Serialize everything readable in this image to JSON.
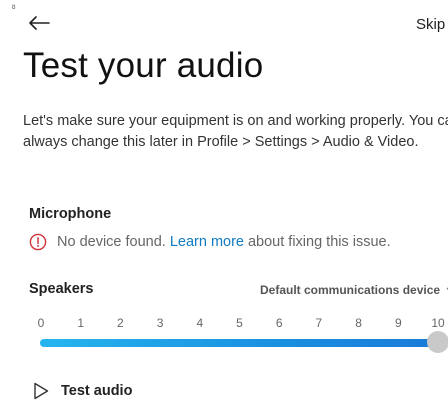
{
  "header": {
    "skip_label": "Skip",
    "cursor_glyph": "ᴽ"
  },
  "title": "Test your audio",
  "description": "Let's make sure your equipment is on and working properly. You can always change this later in Profile > Settings > Audio & Video.",
  "microphone": {
    "label": "Microphone",
    "warning_prefix": "No device found.",
    "warning_link": "Learn more",
    "warning_suffix": "about fixing this issue."
  },
  "speakers": {
    "label": "Speakers",
    "device_value": "Default communications device",
    "scale_ticks": [
      "0",
      "1",
      "2",
      "3",
      "4",
      "5",
      "6",
      "7",
      "8",
      "9",
      "10"
    ],
    "volume_level": 10,
    "volume_max": 10
  },
  "test_audio": {
    "label": "Test audio"
  },
  "colors": {
    "accent": "#0f7bc4",
    "warning": "#d13438",
    "slider_fill": "#1a8fe0",
    "thumb": "#c9c9c9"
  },
  "icons": {
    "back": "arrow-left-icon",
    "warning": "alert-circle-icon",
    "device_chevron": "chevron-down-icon",
    "test_audio": "play-icon"
  }
}
